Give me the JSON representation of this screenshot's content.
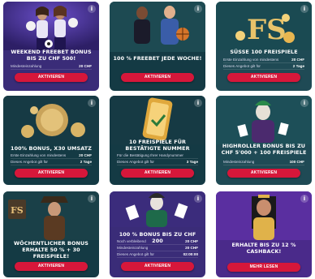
{
  "info_glyph": "i",
  "cards": [
    {
      "title": "Weekend Freebet Bonus bis zu CHF 500!",
      "rows": [
        {
          "label": "Mindesteinzahlung",
          "value": "20 CHF"
        }
      ],
      "button": "Aktivieren"
    },
    {
      "title": "100 % Freebet jede Woche!",
      "rows": [],
      "button": "Aktivieren"
    },
    {
      "title": "Süsse 100 Freispiele",
      "rows": [
        {
          "label": "Erste Einzahlung von mindestens",
          "value": "20 CHF"
        },
        {
          "label": "Dieses Angebot gilt für",
          "value": "2 Tage"
        }
      ],
      "button": "Aktivieren"
    },
    {
      "title": "100% Bonus, X30 Umsatz",
      "rows": [
        {
          "label": "Erste Einzahlung von mindestens",
          "value": "20 CHF"
        },
        {
          "label": "Dieses Angebot gilt für",
          "value": "2 Tage"
        }
      ],
      "button": "Aktivieren"
    },
    {
      "title": "10 Freispiele für bestätigte Nummer",
      "rows": [
        {
          "label": "Für die Bestätigung Ihrer Handynummer",
          "value": ""
        },
        {
          "label": "Dieses Angebot gilt für",
          "value": "3 Tage"
        }
      ],
      "button": "Aktivieren"
    },
    {
      "title": "Highroller Bonus bis zu CHF 5'000 + 100 Freispiele",
      "rows": [
        {
          "label": "Mindesteinzahlung",
          "value": "100 CHF"
        }
      ],
      "button": "Aktivieren"
    },
    {
      "title": "Wöchentlicher Bonus erhalte 50 % + 30 Freispiele!",
      "rows": [],
      "button": "Aktivieren"
    },
    {
      "title": "100 % Bonus bis zu CHF 200",
      "rows": [
        {
          "label": "Noch verbleibend",
          "value": "20 CHF"
        },
        {
          "label": "Mindesteinzahlung",
          "value": "20 CHF"
        },
        {
          "label": "Dieses Angebot gilt für",
          "value": "02:00:00"
        }
      ],
      "button": "Aktivieren"
    },
    {
      "title": "Erhalte bis zu 12 % Cashback!",
      "rows": [],
      "button": "Mehr lesen"
    }
  ]
}
